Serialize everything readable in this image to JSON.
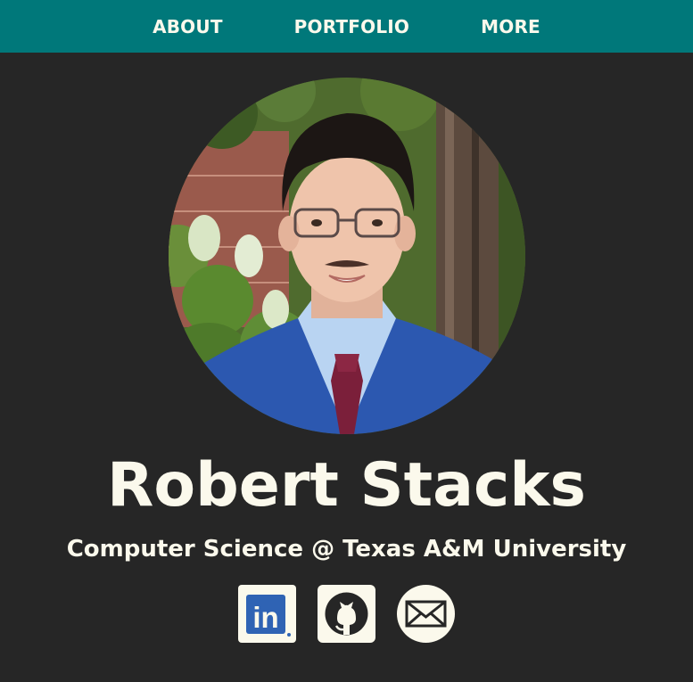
{
  "nav": {
    "items": [
      {
        "label": "ABOUT"
      },
      {
        "label": "PORTFOLIO"
      },
      {
        "label": "MORE"
      }
    ]
  },
  "profile": {
    "name": "Robert Stacks",
    "subtitle": "Computer Science @ Texas A&M University",
    "photo_icon": "profile-photo"
  },
  "social_links": [
    {
      "icon": "linkedin-icon",
      "glyph": "in"
    },
    {
      "icon": "github-icon"
    },
    {
      "icon": "email-icon"
    }
  ],
  "colors": {
    "nav_bg": "#00787a",
    "page_bg": "#262626",
    "text": "#fbf9ec",
    "linkedin_blue": "#2f63b4"
  }
}
